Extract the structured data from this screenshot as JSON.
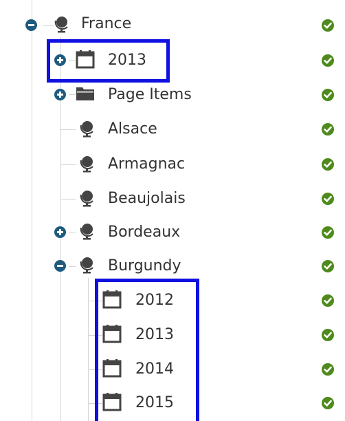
{
  "tree": {
    "items": [
      {
        "label": "France",
        "icon": "globe-icon",
        "toggle": "collapse",
        "status": "check-icon"
      },
      {
        "label": "2013",
        "icon": "calendar-icon",
        "toggle": "expand",
        "status": "check-icon"
      },
      {
        "label": "Page Items",
        "icon": "folder-icon",
        "toggle": "expand",
        "status": "check-icon"
      },
      {
        "label": "Alsace",
        "icon": "globe-icon",
        "toggle": "none",
        "status": "check-icon"
      },
      {
        "label": "Armagnac",
        "icon": "globe-icon",
        "toggle": "none",
        "status": "check-icon"
      },
      {
        "label": "Beaujolais",
        "icon": "globe-icon",
        "toggle": "none",
        "status": "check-icon"
      },
      {
        "label": "Bordeaux",
        "icon": "globe-icon",
        "toggle": "expand",
        "status": "check-icon"
      },
      {
        "label": "Burgundy",
        "icon": "globe-icon",
        "toggle": "collapse",
        "status": "check-icon"
      },
      {
        "label": "2012",
        "icon": "calendar-icon",
        "toggle": "none",
        "status": "check-icon"
      },
      {
        "label": "2013",
        "icon": "calendar-icon",
        "toggle": "none",
        "status": "check-icon"
      },
      {
        "label": "2014",
        "icon": "calendar-icon",
        "toggle": "none",
        "status": "check-icon"
      },
      {
        "label": "2015",
        "icon": "calendar-icon",
        "toggle": "none",
        "status": "check-icon"
      }
    ]
  },
  "colors": {
    "toggle": "#1e5b7f",
    "check": "#4e8a1c",
    "highlight": "#1010e0",
    "icon": "#444444",
    "text": "#333333",
    "tree_line": "#d4d4d4"
  }
}
